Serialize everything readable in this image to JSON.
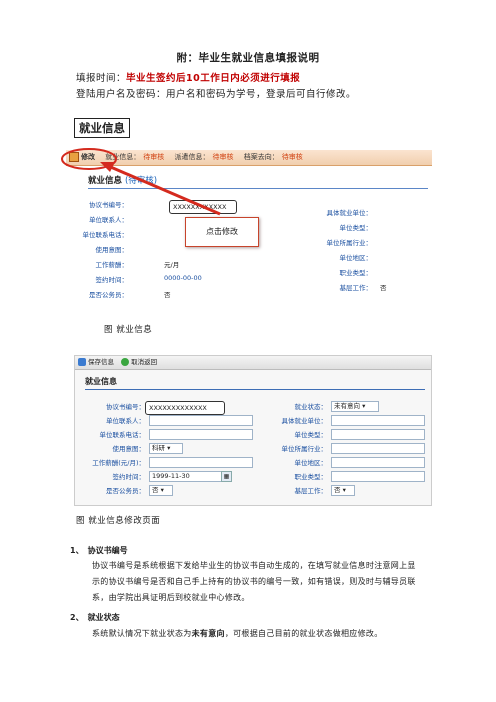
{
  "title": "附：毕业生就业信息填报说明",
  "fill_time": {
    "label": "填报时间：",
    "value": "毕业生签约后10工作日内必须进行填报"
  },
  "login_text": "登陆用户名及密码：用户名和密码为学号，登录后可自行修改。",
  "section_box": "就业信息",
  "shot1": {
    "toolbar": [
      "修改",
      "就业信息：",
      "待审核",
      "派遣信息：",
      "待审核",
      "档案去向：",
      "待审核"
    ],
    "section_title": "就业信息",
    "section_status": "(待审核)",
    "highlight_value": "XXXXXXXXXXXX",
    "popup": "点击修改",
    "left_labels": [
      "协议书编号：",
      "单位联系人：",
      "单位联系电话：",
      "使用意图：",
      "工作薪酬：",
      "签约时间：",
      "是否公务员："
    ],
    "left_values": [
      "",
      "",
      "",
      "",
      "元/月",
      "0000-00-00",
      "否"
    ],
    "right_labels": [
      "具体就业单位：",
      "单位类型：",
      "单位所属行业：",
      "单位地区：",
      "职业类型：",
      "基层工作："
    ],
    "right_values": [
      "",
      "",
      "",
      "",
      "",
      "否"
    ]
  },
  "caption1": "图    就业信息",
  "shot2": {
    "toolbar": [
      "保存信息",
      "取消返回"
    ],
    "section_title": "就业信息",
    "highlight_value": "XXXXXXXXXXXXX",
    "left_labels": [
      "协议书编号：",
      "单位联系人：",
      "单位联系电话：",
      "使用意图：",
      "工作薪酬(元/月)：",
      "签约时间：",
      "是否公务员："
    ],
    "left_values": [
      "",
      "",
      "",
      "科研",
      "",
      "1999-11-30",
      "否"
    ],
    "right_labels": [
      "就业状态：",
      "具体就业单位：",
      "单位类型：",
      "单位所属行业：",
      "单位地区：",
      "职业类型：",
      "基层工作："
    ],
    "right_values": [
      "未有意向",
      "",
      "",
      "",
      "",
      "",
      "否"
    ]
  },
  "caption2": "图    就业信息修改页面",
  "items": [
    {
      "number": "1、",
      "heading": "协议书编号",
      "text": "协议书编号是系统根据下发给毕业生的协议书自动生成的，在填写就业信息时注意网上显示的协议书编号是否和自己手上持有的协议书的编号一致，如有错误，则及时与辅导员联系，由学院出具证明后到校就业中心修改。"
    },
    {
      "number": "2、",
      "heading": "就业状态",
      "text_pre": "系统默认情况下就业状态为",
      "text_bold": "未有意向",
      "text_post": "，可根据自己目前的就业状态做相应修改。"
    }
  ],
  "colors": {
    "emphasis_red": "#c00000",
    "label_blue": "#1a4fa0",
    "arrow_red": "#d42a1e"
  }
}
